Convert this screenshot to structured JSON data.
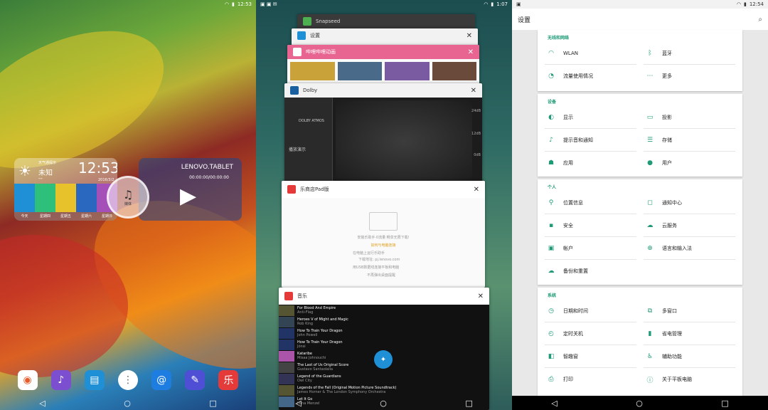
{
  "home": {
    "status_time": "12:53",
    "weather": {
      "title": "天气通提示",
      "status": "未知",
      "dash": "--",
      "time": "12:53",
      "date": "2016/3/2",
      "days": [
        "今天",
        "星期四",
        "星期五",
        "星期六",
        "星期日"
      ]
    },
    "music": {
      "title": "LENOVO.TABLET",
      "time": "00:00:00/00:00:00",
      "btn_label": "媒体"
    },
    "dock": [
      "相机",
      "音乐",
      "演示",
      "应用",
      "邮件",
      "笔记",
      "乐商店"
    ]
  },
  "recents": {
    "status_time": "1:07",
    "cards": [
      {
        "title": "Snapseed"
      },
      {
        "title": "设置"
      },
      {
        "title": "哔哩哔哩动画"
      },
      {
        "title": "Dolby",
        "brand": "DOLBY ATMOS",
        "menu": "播放演示",
        "db_labels": [
          "24dB",
          "12dB",
          "0dB"
        ]
      },
      {
        "title": "乐商店Pad版",
        "lines": [
          "安装乐助手·0流量 畅享无限下载!",
          "如何与电脑连接",
          "在电脑上运行乐助手",
          "下载地址: pj.lenovo.com",
          "用USB数据线连接平板和电脑",
          "不再弹出桌面提醒"
        ]
      },
      {
        "title": "音乐",
        "tracks": [
          {
            "t": "For Blood And Empire",
            "a": "Anti-Flag"
          },
          {
            "t": "Heroes V of Might and Magic",
            "a": "Rob King"
          },
          {
            "t": "How To Train Your Dragon",
            "a": "John Powell"
          },
          {
            "t": "How To Train Your Dragon",
            "a": "Jónsi"
          },
          {
            "t": "Kataribe",
            "a": "Misaa Johnouchi"
          },
          {
            "t": "The Last of Us Original Score",
            "a": "Gustavo Santaolalla"
          },
          {
            "t": "Legend of the Guardians",
            "a": "Owl City"
          },
          {
            "t": "Legends of the Fall (Original Motion Picture Soundtrack)",
            "a": "James Horner & The London Symphony Orchestra"
          },
          {
            "t": "Let It Go",
            "a": "Idina Menzel"
          }
        ]
      }
    ]
  },
  "settings": {
    "status_time": "12:54",
    "title": "设置",
    "sections": [
      {
        "header": "无线和网络",
        "items": [
          "WLAN",
          "蓝牙",
          "流量使用情况",
          "更多"
        ]
      },
      {
        "header": "设备",
        "items": [
          "显示",
          "投影",
          "提示音和通知",
          "存储",
          "应用",
          "用户"
        ]
      },
      {
        "header": "个人",
        "items": [
          "位置信息",
          "通知中心",
          "安全",
          "云服务",
          "帐户",
          "语言和输入法",
          "备份和重置"
        ]
      },
      {
        "header": "系统",
        "items": [
          "日期和时间",
          "多窗口",
          "定时关机",
          "省电管理",
          "智趣窗",
          "辅助功能",
          "打印",
          "关于平板电脑"
        ]
      }
    ]
  },
  "icons": {
    "wifi": "wifi-icon",
    "bt": "bluetooth-icon"
  }
}
